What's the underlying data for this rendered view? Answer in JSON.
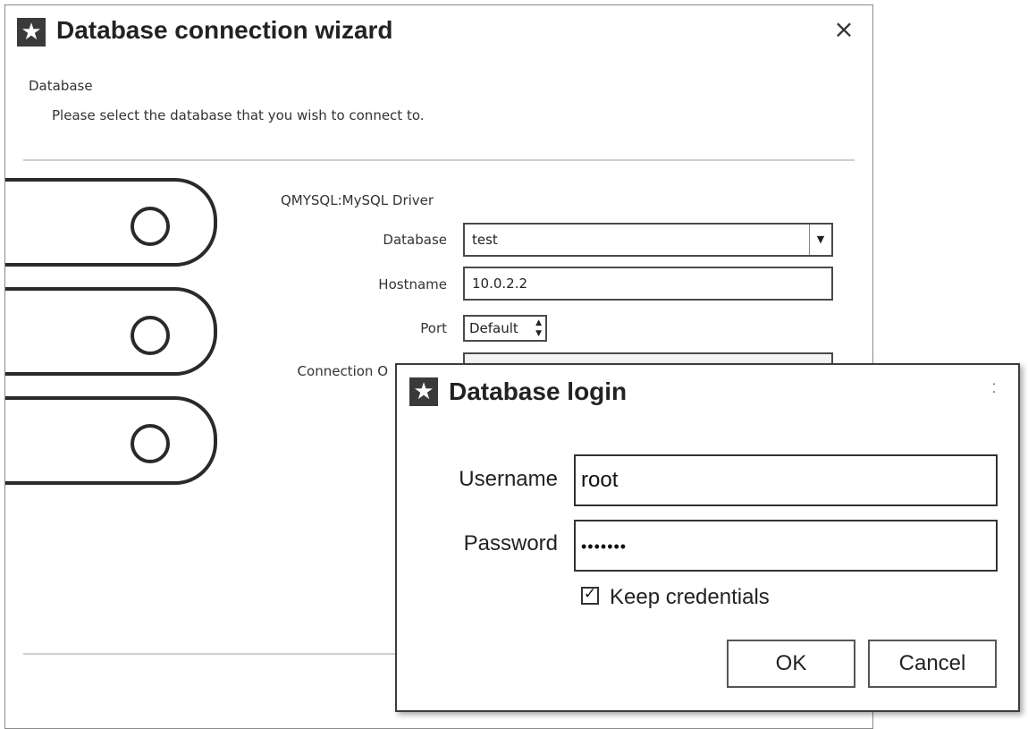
{
  "wizard": {
    "title": "Database connection wizard",
    "close_glyph": "×",
    "section_title": "Database",
    "section_subtitle": "Please select the database that you wish to connect to.",
    "driver_label": "QMYSQL:MySQL Driver",
    "fields": {
      "database_label": "Database",
      "database_value": "test",
      "hostname_label": "Hostname",
      "hostname_value": "10.0.2.2",
      "port_label": "Port",
      "port_value": "Default",
      "connection_options_label": "Connection O"
    },
    "icon": "star-icon",
    "art_icon": "server-stack-icon"
  },
  "login": {
    "title": "Database login",
    "close_glyph": "⁚",
    "username_label": "Username",
    "username_value": "root",
    "password_label": "Password",
    "password_value": "•••••••",
    "keep_credentials_label": "Keep credentials",
    "keep_credentials_checked": true,
    "check_glyph": "✓",
    "ok_label": "OK",
    "cancel_label": "Cancel",
    "icon": "star-icon"
  }
}
